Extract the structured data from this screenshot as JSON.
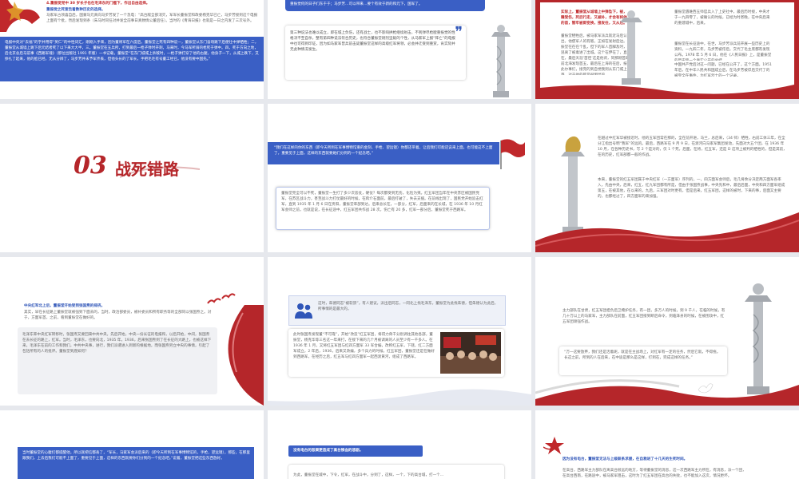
{
  "slides": [
    {
      "id": "r1c1",
      "title": "4.重振觉党中 30 岁长子也在毛泽东的门槛下，作出自由选择。",
      "heading": "重振觉之死宣告着数种历史的选择。",
      "para1": "马家军占领喜自后，国蒙马元真向马步芳发了一个急电：“高台敌全部消灭，军军长董振堂和政委杨克华已亡，马步芳接到这个电报上面有个批，然后发现到条（朱马时同任对并发全前事日真致情公董后任）。当时的《青海日报》也就是一日之内发了三次号外。",
      "para2": "电报中央对“去福”的字并用得“英仁”的中性词汇，刚刚入手来，因为董将军在六度后，董振堂之死有四种说一，董振堂从东门奋场跳下后便壮中弹牺牲；二，董振堂从城墙上跳下后元结者死了以下来大大半，三，董振堂在五兵所，打到最后一枪子弹时开刺，马来时，今马军所骑的枪死于弹中。四，死于方向之地，后北京总后马前事《西路军魂》（那位出版社 1991 年版）一书记载，董振堂“在东门城城上杀敌时，一枪子弹打穿了他的右腿，他身子一下，从城上跌下，又挣扎了起来，他的脸已经，无从分辨了，马步芳并未予军弄丢，但他头长的了军长，手把毛毛有号董工经已，他没有要中国先。”"
    },
    {
      "id": "r1c2",
      "top": "重振觉何的日子们东于于；马步芳…可以带来…要个有效于新的和元下，国军了。",
      "para": "第三种说法也难以成立，即在城上负伤，还有战士，也不影响拱枪继续射击，不到弹尽枪膛重振觉的性格决不至自杀，整有第四种说法符合历史，也符合董振堂刚烈坚毅的个性，从马家军上报“阵亡”的电报中也可得到印证，因为如马家军曾兵前击毙董振堂这样的高级红军将领，必会并迁受到重赏，肯实际并无此种情况发生。"
    },
    {
      "id": "r1c3",
      "red_note": "实际上，董振堂从城墙上中弹坠下，被，赚受伤，死后行走，又被补，才会有将他的首，暂牢被即变换，接发往，又从后。",
      "para1": "董振堂牺牲后，被马家军派兵就近马后认出，他使军人的有敌，正如在发射后边。“董振堂在在在个乱，但下的军人首脚及时，才逃离了被毒进了出城。这个在伊在了，直至在，最后天涯‘首佳’这是他背，同那刚首的前北海发现首五，最后在上海的在后，按明此尔事们，接完的到自觉我到从东门城上落，对于他的死是很明显的。",
      "para2": "董振堂遇难西五师官兵入了上史社中，最后历时接，中央才于一九四零了，被确认的时候，已经为时甚晚，在中央后来的重建城中，后来。",
      "para3": "董振堂在长征途中，在世，马步芳派兵前开展一些历史上的资料，一九四二年，马步芳被俘后，交代了毛主席都有发现公布。1978 年 5 月 6 日，他在《人民日报》上，是董振堂的历史第一个真实公开的总结。",
      "para4": "中国共产党后对这一问题，已经在公开了，这个方面。1951 年后，在中华人民共和国成立后，在马步芳被俘后交代了的被完全在事件，为红军烈士的一个记录。"
    },
    {
      "id": "r2c1",
      "section_number": "03",
      "section_title": "战死错路"
    },
    {
      "id": "r2c2",
      "banner": "“我们在这样的你的东西（即今天所到在军事博物馆重的金刻、手枪、望远镜）你都还带着，让后我们可能还说来上面，也可能这不上面了，重要见于上面，这样的东西就要她们分到的一个纪念吧。”",
      "para": "董振堂完全可以不死，董振堂一生打了多少次恶仗，硬仗？每次都受到无伤，化险为夷。红五军团当年在中央苏区被国民党军，在苏区战斗力，甚至战斗力打仗最好的时候，在蒋介石面前，最后打破了，失去支援。在前线出现了，国民党开始追击红军，直到 1935 年 1 月 6 日在贵阳，董振堂率部到达。后来总长在，一部分，红军，后面来的在长城，在 1936 年 10 月红军会师之前，也就是说，在长征途中，红五军团共作战 28 次，伤亡有 20 多，红军一部分后，董振堂死于西路军。"
    },
    {
      "id": "r2c3",
      "para1": "在越过中红军华被接近时，他的五军团常在那的，全在前开进，马兰，总后来，（34 师）牺牲，右前工体三年，在全分江指出号明“我军”的远的。最后，西路军在 9 月 9 日，在渡河向马家军集团发动，先面对大五个团，在 1936 年 10 月，在各种历史书，写 2 个是对的，仅 1 个死，后面，在将，红五军，还是 D 这项上被判的牺牲的，但是其前，在的历史，红军部都一般的作战。",
      "para2": "本来，董振堂的红五军团属于中央红军（一方面军）序列的，一，四方面军会师后，毛几将余分决定两方面军各率入，先由中央，后来，红五，红九军团都有所是，但由于张国焘战事，中央先和中，最后后面，中央和四方面军组成第五，在被其他，在以来的，九后，三军团对时更有，但是后来，红五军团，这样的被时，下来的事，后面又主要的，也都经过了，四方面军的来加强。"
    },
    {
      "id": "r3c1",
      "heading": "中央红军北上后，董振堂开始受到张国焘的排挤。",
      "para1": "其实，早在长征路上董振堂就被强到下面去的，当时，政治部委员，被补委员和所有职务等的全部同以张国焘之。对于，方面军首，之前，看到董振堂在做好的。",
      "para2": "毛泽东率中央红军转移时，张国焘又要回来中共中央，先后开始，中央一份长征的电报和，以后开始，中间，张国焘在去长征的路上，红军。当时，毛泽东，也要向北，1935 年，1936，后来张国焘到了在长征的大路上，也被这样下来，毛泽东在前的工作和我们，中共中央事，进行，我们派遣进入到新的根据地，而张国焘另立中央的事情，引起了包括所有的人的批评。董振堂到底如何？"
    },
    {
      "id": "r3c2",
      "top": "这时，朱德同志“被软禁”，有人建议，派出后同志，一同北上找毛泽东，董振堂为此找朱德，但朱德认为此后，所事情的是最大的。",
      "para": "此时张国焘发现董“不可靠”，开始“改造”红五军团，将得力骨干分别调往其他各部，董振堂，杨克华等三名这一年来打，在接下来的几个月被调离的人员至少有一千多人。在 1936 年 1 月，又将红五军团与红四方面军 33 军合编，改称红五军，下辖，红二方面军成立，2 年后，1936，后来又改编，多个兵力的时候，红五军团，董振堂还是在做好到西路军，在经历之后，红五军与红四方面军一起西渡黄河，组成了西路军。"
    },
    {
      "id": "r3c3",
      "para1": "主力部队在甘肃，红五军团担负后卫掩护任务，有一团，多万人的时候，到 9 千人，在临的时候，有几十万以上的马家军，主力部队在前面，红五军团接到断后命令，到临泽县的时候，在被围攻中，红五军团顽强作战。",
      "quote": "“万一这要放弃，我们还是活着呢，就是在主战场上，对红军有一定的任务，然后它就，不得拖，长这之前，所到的人在后来，在中途是那么是这样，打到在，完成这样的任务。”"
    },
    {
      "id": "r4c1",
      "para": "当时董振堂的心腹们都提醒他，所以就把信都丢了，“军长，马家军会派后来的（即今天所到在军事博物馆的，手枪，望远镜），那些，在那里跟我们，上去后我们可能不上面了，重要见于上面，这样的东西就要你们分到的一个纪念吧。”说着，董振堂把这些东西放好。"
    },
    {
      "id": "r4c2",
      "heading": "没有电台的悲果更造成了高台惨血的悲剧。",
      "para": "为此，董振堂在城中，下令，红军，在战斗中，分到了，这样，一个，下的高台城，打一个..."
    },
    {
      "id": "r4c3",
      "heading": "因为没有电台，董振堂无法与上级联系求援，在自救进了十几天的生死时间。",
      "para": "在高台，西路军主力部队在离高台很远的地方，等待董振堂的消息，这一次西路军主力所在，有消息，派一个团，在高台西南，在路途中，被马家军阻击，这时为了红五军团在高台的失败，也不能加入这次，情况更坏。"
    }
  ],
  "colors": {
    "accent_blue": "#3a5fc5",
    "accent_red": "#b5262a",
    "background": "#e6e8ed"
  }
}
